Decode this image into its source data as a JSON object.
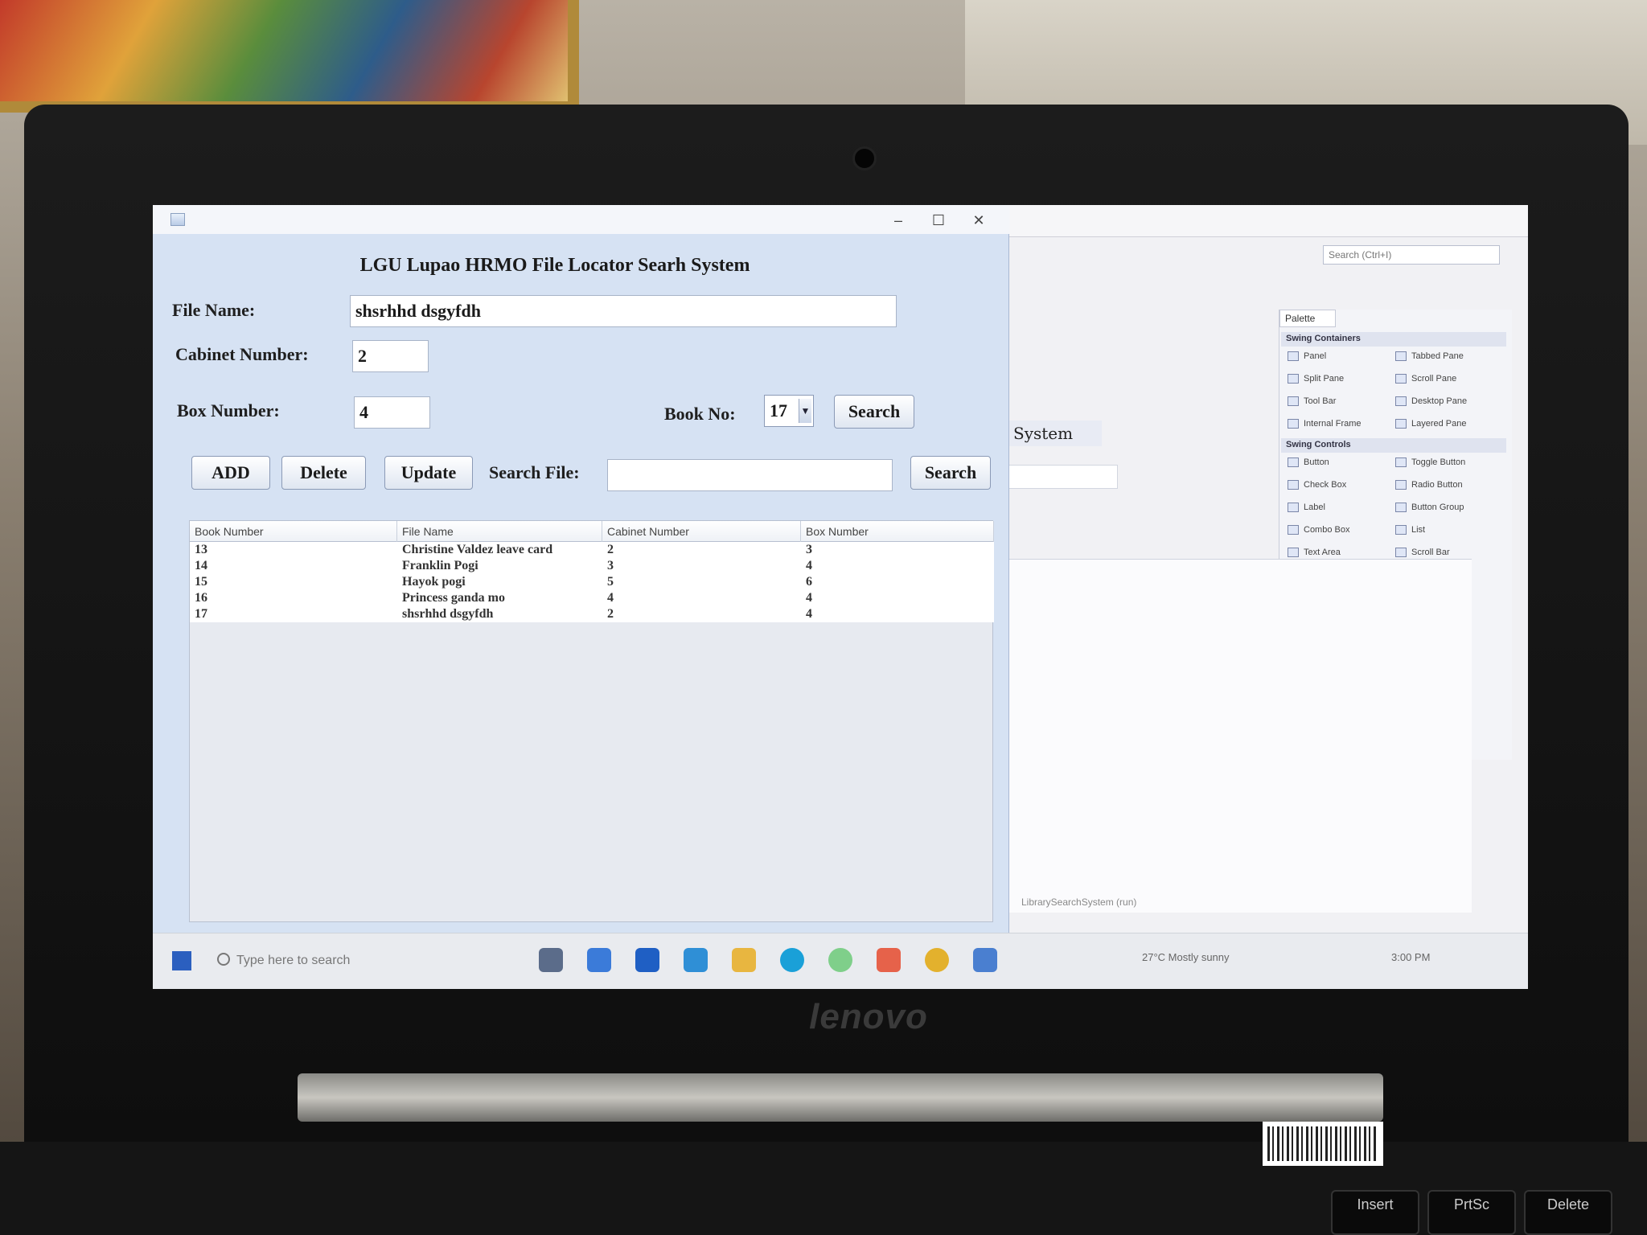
{
  "app": {
    "title": "LGU Lupao HRMO File Locator Searh System",
    "labels": {
      "file_name": "File Name:",
      "cabinet_number": "Cabinet Number:",
      "box_number": "Box Number:",
      "book_no": "Book No:",
      "search_file": "Search File:"
    },
    "fields": {
      "file_name_value": "shsrhhd dsgyfdh",
      "cabinet_number_value": "2",
      "box_number_value": "4",
      "book_no_selected": "17",
      "search_file_value": ""
    },
    "buttons": {
      "search_book": "Search",
      "add": "ADD",
      "delete": "Delete",
      "update": "Update",
      "search_file": "Search"
    },
    "window_controls": {
      "minimize": "–",
      "maximize": "☐",
      "close": "✕"
    },
    "table": {
      "columns": [
        "Book Number",
        "File Name",
        "Cabinet Number",
        "Box Number"
      ],
      "rows": [
        [
          "13",
          "Christine Valdez leave card",
          "2",
          "3"
        ],
        [
          "14",
          "Franklin Pogi",
          "3",
          "4"
        ],
        [
          "15",
          "Hayok pogi",
          "5",
          "6"
        ],
        [
          "16",
          "Princess ganda mo",
          "4",
          "4"
        ],
        [
          "17",
          "shsrhhd dsgyfdh",
          "2",
          "4"
        ]
      ]
    }
  },
  "ide": {
    "search_placeholder": "Search (Ctrl+I)",
    "palette_tab": "Palette",
    "palette_sections": [
      "Swing Containers",
      "Swing Controls"
    ],
    "palette_containers": [
      "Panel",
      "Tabbed Pane",
      "Split Pane",
      "Scroll Pane",
      "Tool Bar",
      "Desktop Pane",
      "Internal Frame",
      "Layered Pane"
    ],
    "palette_controls": [
      "Button",
      "Toggle Button",
      "Check Box",
      "Radio Button",
      "Label",
      "Button Group",
      "Combo Box",
      "List",
      "Text Area",
      "Scroll Bar"
    ],
    "design_label": "System",
    "status_text": "LibrarySearchSystem (run)"
  },
  "taskbar": {
    "search_placeholder": "Type here to search",
    "weather": "27°C  Mostly sunny",
    "time": "3:00 PM"
  },
  "device": {
    "brand": "lenovo",
    "keys": [
      "Insert",
      "PrtSc",
      "Delete"
    ]
  }
}
